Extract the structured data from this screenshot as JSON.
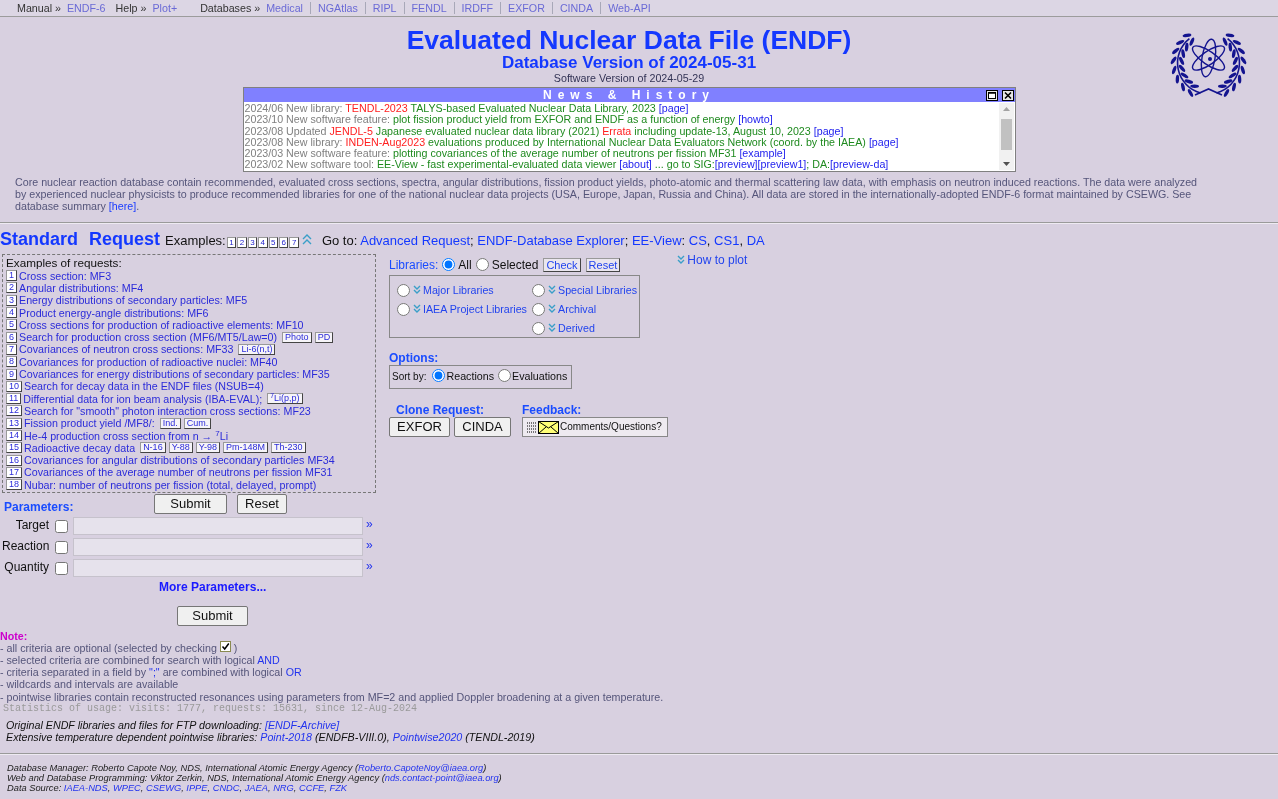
{
  "top_nav": {
    "groups": [
      {
        "kind": "pair",
        "label": "Manual »",
        "links": [
          "ENDF-6"
        ]
      },
      {
        "kind": "pair",
        "label": "Help »",
        "links": [
          "Plot+"
        ]
      },
      {
        "kind": "list",
        "label": "Databases »",
        "links": [
          "Medical",
          "NGAtlas",
          "RIPL",
          "FENDL",
          "IRDFF",
          "EXFOR",
          "CINDA",
          "Web-API"
        ]
      }
    ]
  },
  "header": {
    "title": "Evaluated Nuclear Data File (ENDF)",
    "subtitle": "Database Version of 2024-05-31",
    "software_version": "Software Version of 2024-05-29"
  },
  "news": {
    "title": "News & History",
    "entries": [
      {
        "segments": [
          {
            "kind": "muted",
            "text": "2024/06 New library: "
          },
          {
            "kind": "name",
            "text": "TENDL-2023"
          },
          {
            "kind": "info",
            "text": " TALYS-based Evaluated Nuclear Data Library, 2023 "
          },
          {
            "kind": "link",
            "text": "[page]"
          }
        ]
      },
      {
        "segments": [
          {
            "kind": "muted",
            "text": "2023/10 New software feature: "
          },
          {
            "kind": "info",
            "text": "plot fission product yield from EXFOR and ENDF as a function of energy "
          },
          {
            "kind": "link",
            "text": "[howto]"
          }
        ]
      },
      {
        "segments": [
          {
            "kind": "muted",
            "text": "2023/08 Updated "
          },
          {
            "kind": "name",
            "text": "JENDL-5"
          },
          {
            "kind": "info",
            "text": " Japanese evaluated nuclear data library (2021) "
          },
          {
            "kind": "name",
            "text": "Errata"
          },
          {
            "kind": "info",
            "text": " including update-13, August 10, 2023 "
          },
          {
            "kind": "link",
            "text": "[page]"
          }
        ]
      },
      {
        "segments": [
          {
            "kind": "muted",
            "text": "2023/08 New library: "
          },
          {
            "kind": "name",
            "text": "INDEN-Aug2023"
          },
          {
            "kind": "info",
            "text": " evaluations produced by International Nuclear Data Evaluators Network (coord. by the IAEA) "
          },
          {
            "kind": "link",
            "text": "[page]"
          }
        ]
      },
      {
        "segments": [
          {
            "kind": "muted",
            "text": "2023/03 New software feature: "
          },
          {
            "kind": "info",
            "text": "plotting covariances of the average number of neutrons per fission MF31 "
          },
          {
            "kind": "link",
            "text": "[example]"
          }
        ]
      },
      {
        "segments": [
          {
            "kind": "muted",
            "text": "2023/02 New software tool: "
          },
          {
            "kind": "info",
            "text": "EE-View - fast experimental-evaluated data viewer "
          },
          {
            "kind": "link",
            "text": "[about]"
          },
          {
            "kind": "info",
            "text": " ... go to SIG:"
          },
          {
            "kind": "link",
            "text": "[preview]"
          },
          {
            "kind": "link",
            "text": "[preview1]"
          },
          {
            "kind": "info",
            "text": "; DA:"
          },
          {
            "kind": "link",
            "text": "[preview-da]"
          }
        ]
      }
    ]
  },
  "description": {
    "segments": [
      {
        "kind": "text",
        "text": "Core nuclear reaction database contain recommended, evaluated cross sections, spectra, angular distributions, fission product yields, photo-atomic and thermal scattering law data, with emphasis on neutron induced reactions. The data were analyzed by experienced nuclear physicists to produce recommended libraries for one of the national nuclear data projects (USA, Europe, Japan, Russia and China). All data are stored in the internationally-adopted ENDF-6 format maintained by CSEWG. See database summary "
      },
      {
        "kind": "link",
        "text": "[here]"
      },
      {
        "kind": "text",
        "text": "."
      }
    ]
  },
  "standard_request": {
    "title": "Standard Request",
    "examples_label": "Examples:",
    "example_shortcuts": [
      "1",
      "2",
      "3",
      "4",
      "5",
      "6",
      "7"
    ],
    "goto": {
      "segments": [
        {
          "kind": "text",
          "text": "Go to: "
        },
        {
          "kind": "link",
          "text": "Advanced Request"
        },
        {
          "kind": "text",
          "text": "; "
        },
        {
          "kind": "link",
          "text": "ENDF-Database Explorer"
        },
        {
          "kind": "text",
          "text": "; "
        },
        {
          "kind": "link",
          "text": "EE-View"
        },
        {
          "kind": "text",
          "text": ": "
        },
        {
          "kind": "link",
          "text": "CS"
        },
        {
          "kind": "text",
          "text": ", "
        },
        {
          "kind": "link",
          "text": "CS1"
        },
        {
          "kind": "text",
          "text": ", "
        },
        {
          "kind": "link",
          "text": "DA"
        }
      ]
    }
  },
  "examples": {
    "heading": "Examples of requests:",
    "items": [
      {
        "number": "1",
        "text": "Cross section: MF3"
      },
      {
        "number": "2",
        "text": "Angular distributions: MF4"
      },
      {
        "number": "3",
        "text": "Energy distributions of secondary particles: MF5"
      },
      {
        "number": "4",
        "text": "Product energy-angle distributions: MF6"
      },
      {
        "number": "5",
        "text": "Cross sections for production of radioactive elements: MF10"
      },
      {
        "number": "6",
        "text": "Search for production cross section (MF6/MT5/Law=0)",
        "tags": [
          "Photo",
          "PD"
        ]
      },
      {
        "number": "7",
        "text": "Covariances of neutron cross sections: MF33",
        "tags": [
          "Li-6(n,t)"
        ]
      },
      {
        "number": "8",
        "text": "Covariances for production of radioactive nuclei: MF40"
      },
      {
        "number": "9",
        "text": "Covariances for energy distributions of secondary particles: MF35"
      },
      {
        "number": "10",
        "text": "Search for decay data in the ENDF files (NSUB=4)"
      },
      {
        "number": "11",
        "text": "Differential data for ion beam analysis (IBA-EVAL);",
        "tags": [
          "$^{7}$Li(p,p)"
        ]
      },
      {
        "number": "12",
        "text": "Search for \"smooth\" photon interaction cross sections: MF23"
      },
      {
        "number": "13",
        "text": "Fission product yield /MF8/:",
        "tags": [
          "Ind.",
          "Cum."
        ]
      },
      {
        "number": "14",
        "text": "He-4 production cross section from  n → $^{7}$Li"
      },
      {
        "number": "15",
        "text": "Radioactive decay data",
        "tags": [
          "N-16",
          "Y-88",
          "Y-98",
          "Pm-148M",
          "Th-230"
        ]
      },
      {
        "number": "16",
        "text": "Covariances for angular distributions of secondary particles MF34"
      },
      {
        "number": "17",
        "text": "Covariances of the average number of neutrons per fission MF31"
      },
      {
        "number": "18",
        "text": "Nubar: number of neutrons per fission (total, delayed, prompt)"
      }
    ]
  },
  "request_buttons": [
    "Submit",
    "Reset"
  ],
  "parameters": {
    "label": "Parameters:",
    "rows": [
      {
        "label": "Target",
        "checked": false,
        "expand": "»"
      },
      {
        "label": "Reaction",
        "checked": false,
        "expand": "»"
      },
      {
        "label": "Quantity",
        "checked": false,
        "expand": "»"
      }
    ],
    "more": "More Parameters...",
    "submit": "Submit"
  },
  "libraries": {
    "label": "Libraries:",
    "scope": [
      {
        "label": "All",
        "selected": true
      },
      {
        "label": "Selected",
        "selected": false
      }
    ],
    "buttons": [
      "Check",
      "Reset"
    ],
    "how_to_plot": "How to plot",
    "columns": [
      [
        {
          "label": "Major Libraries",
          "selected": false
        },
        {
          "label": "IAEA Project Libraries",
          "selected": false
        }
      ],
      [
        {
          "label": "Special Libraries",
          "selected": false
        },
        {
          "label": "Archival",
          "selected": false
        },
        {
          "label": "Derived",
          "selected": false
        }
      ]
    ]
  },
  "options": {
    "label": "Options:",
    "sort_label": "Sort by:",
    "sort": [
      {
        "label": "Reactions",
        "selected": true
      },
      {
        "label": "Evaluations",
        "selected": false
      }
    ]
  },
  "clone": {
    "label": "Clone Request:",
    "buttons": [
      "EXFOR",
      "CINDA"
    ]
  },
  "feedback": {
    "label": "Feedback:",
    "button": "Comments/Questions?"
  },
  "note": {
    "title": "Note:",
    "lines": [
      {
        "segments": [
          {
            "kind": "text",
            "text": "- all criteria are optional (selected by checking"
          },
          {
            "kind": "checkbox"
          },
          {
            "kind": "text",
            "text": ")"
          }
        ]
      },
      {
        "segments": [
          {
            "kind": "text",
            "text": "- selected criteria are combined for search with logical "
          },
          {
            "kind": "em",
            "text": "AND"
          }
        ]
      },
      {
        "segments": [
          {
            "kind": "text",
            "text": "- criteria separated in a field by "
          },
          {
            "kind": "em",
            "text": "\";\""
          },
          {
            "kind": "text",
            "text": " are combined with logical "
          },
          {
            "kind": "em",
            "text": "OR"
          }
        ]
      },
      {
        "segments": [
          {
            "kind": "text",
            "text": "- wildcards and intervals are available"
          }
        ]
      },
      {
        "segments": [
          {
            "kind": "text",
            "text": "- pointwise libraries contain reconstructed resonances using parameters from MF=2 and applied Doppler broadening at a given temperature."
          }
        ]
      }
    ]
  },
  "statistics": "Statistics of usage: visits: 1777, requests: 15631, since 12-Aug-2024",
  "downloads": {
    "lines": [
      {
        "segments": [
          {
            "kind": "text",
            "text": "Original ENDF libraries and files for FTP downloading: "
          },
          {
            "kind": "link",
            "text": "[ENDF-Archive]"
          }
        ]
      },
      {
        "segments": [
          {
            "kind": "text",
            "text": "Extensive temperature dependent pointwise libraries: "
          },
          {
            "kind": "link",
            "text": "Point-2018"
          },
          {
            "kind": "text",
            "text": " (ENDFB-VIII.0), "
          },
          {
            "kind": "link",
            "text": "Pointwise2020"
          },
          {
            "kind": "text",
            "text": " (TENDL-2019)"
          }
        ]
      }
    ]
  },
  "footer": {
    "lines": [
      {
        "segments": [
          {
            "kind": "text",
            "text": "Database Manager: Roberto Capote Noy, NDS, International Atomic Energy Agency ("
          },
          {
            "kind": "link",
            "text": "Roberto.CapoteNoy@iaea.org"
          },
          {
            "kind": "text",
            "text": ")"
          }
        ]
      },
      {
        "segments": [
          {
            "kind": "text",
            "text": "Web and Database Programming: Viktor Zerkin, NDS, International Atomic Energy Agency ("
          },
          {
            "kind": "link",
            "text": "nds.contact-point@iaea.org"
          },
          {
            "kind": "text",
            "text": ")"
          }
        ]
      },
      {
        "segments": [
          {
            "kind": "text",
            "text": "Data Source: "
          },
          {
            "kind": "link",
            "text": "IAEA-NDS"
          },
          {
            "kind": "text",
            "text": ", "
          },
          {
            "kind": "link",
            "text": "WPEC"
          },
          {
            "kind": "text",
            "text": ", "
          },
          {
            "kind": "link",
            "text": "CSEWG"
          },
          {
            "kind": "text",
            "text": ", "
          },
          {
            "kind": "link",
            "text": "IPPE"
          },
          {
            "kind": "text",
            "text": ", "
          },
          {
            "kind": "link",
            "text": "CNDC"
          },
          {
            "kind": "text",
            "text": ", "
          },
          {
            "kind": "link",
            "text": "JAEA"
          },
          {
            "kind": "text",
            "text": ", "
          },
          {
            "kind": "link",
            "text": "NRG"
          },
          {
            "kind": "text",
            "text": ", "
          },
          {
            "kind": "link",
            "text": "CCFE"
          },
          {
            "kind": "text",
            "text": ", "
          },
          {
            "kind": "link",
            "text": "FZK"
          }
        ]
      }
    ]
  }
}
